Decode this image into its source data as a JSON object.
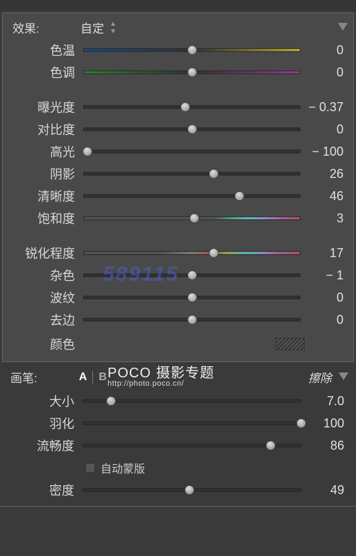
{
  "effects": {
    "title": "效果:",
    "preset": "自定",
    "sliders": [
      {
        "label": "色温",
        "value": "0",
        "pos": 50,
        "track": "gradient-wb"
      },
      {
        "label": "色调",
        "value": "0",
        "pos": 50,
        "track": "gradient-tint"
      },
      {
        "label": "_gap"
      },
      {
        "label": "曝光度",
        "value": "− 0.37",
        "pos": 47,
        "track": ""
      },
      {
        "label": "对比度",
        "value": "0",
        "pos": 50,
        "track": ""
      },
      {
        "label": "高光",
        "value": "− 100",
        "pos": 2,
        "track": ""
      },
      {
        "label": "阴影",
        "value": "26",
        "pos": 60,
        "track": ""
      },
      {
        "label": "清晰度",
        "value": "46",
        "pos": 72,
        "track": ""
      },
      {
        "label": "饱和度",
        "value": "3",
        "pos": 51,
        "track": "gradient-sat"
      },
      {
        "label": "_gap"
      },
      {
        "label": "锐化程度",
        "value": "17",
        "pos": 60,
        "track": "gradient-rainbow"
      },
      {
        "label": "杂色",
        "value": "− 1",
        "pos": 50,
        "track": ""
      },
      {
        "label": "波纹",
        "value": "0",
        "pos": 50,
        "track": ""
      },
      {
        "label": "去边",
        "value": "0",
        "pos": 50,
        "track": ""
      }
    ],
    "color_label": "颜色"
  },
  "brush": {
    "title": "画笔:",
    "optA": "A",
    "optB": "B",
    "erase": "擦除",
    "sliders": [
      {
        "label": "大小",
        "value": "7.0",
        "pos": 13
      },
      {
        "label": "羽化",
        "value": "100",
        "pos": 100
      },
      {
        "label": "流畅度",
        "value": "86",
        "pos": 86
      }
    ],
    "automask": "自动蒙版",
    "density": {
      "label": "密度",
      "value": "49",
      "pos": 49
    }
  },
  "watermark": {
    "brand": "POCO",
    "suffix": "摄影专题",
    "url": "http://photo.poco.cn/",
    "number": "589115"
  }
}
